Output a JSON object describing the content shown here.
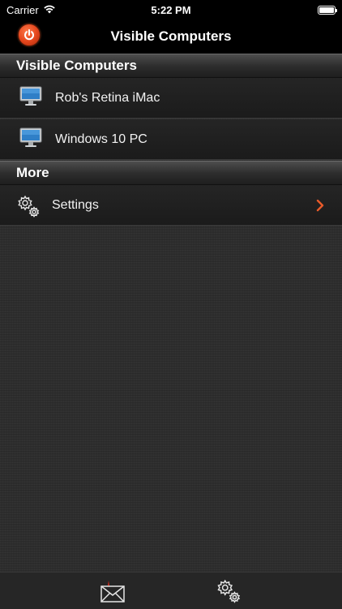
{
  "status_bar": {
    "carrier": "Carrier",
    "time": "5:22 PM"
  },
  "nav": {
    "title": "Visible Computers",
    "power_icon": "power-icon"
  },
  "sections": {
    "visible_computers": {
      "header": "Visible Computers",
      "items": [
        {
          "label": "Rob's Retina iMac",
          "icon": "monitor-icon"
        },
        {
          "label": "Windows 10 PC",
          "icon": "monitor-icon"
        }
      ]
    },
    "more": {
      "header": "More",
      "items": [
        {
          "label": "Settings",
          "icon": "gears-icon"
        }
      ]
    }
  },
  "tab_bar": {
    "items": [
      {
        "icon": "mail-icon"
      },
      {
        "icon": "gears-icon"
      }
    ]
  },
  "colors": {
    "accent": "#e85a2a",
    "background": "#2d2d2d",
    "bar": "#000000"
  }
}
